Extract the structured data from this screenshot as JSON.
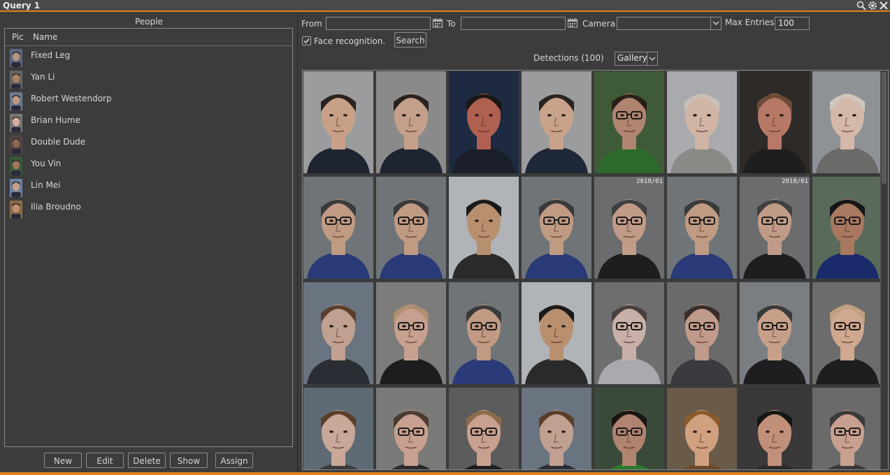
{
  "window": {
    "title": "Query 1"
  },
  "people": {
    "label": "People",
    "col_pic": "Pic",
    "col_name": "Name",
    "items": [
      {
        "name": "Fixed Leg",
        "skin": "#b89478",
        "bg": "#5a6880"
      },
      {
        "name": "Yan Li",
        "skin": "#a88466",
        "bg": "#666"
      },
      {
        "name": "Robert Westendorp",
        "skin": "#c09a80",
        "bg": "#6b7a90"
      },
      {
        "name": "Brian Hume",
        "skin": "#d6b0a0",
        "bg": "#787878"
      },
      {
        "name": "Double Dude",
        "skin": "#8a6a50",
        "bg": "#544"
      },
      {
        "name": "You Vin",
        "skin": "#a0785a",
        "bg": "#3a5a3a"
      },
      {
        "name": "Lin Mei",
        "skin": "#c8a088",
        "bg": "#6c80a0"
      },
      {
        "name": "Ilia Broudno",
        "skin": "#c09070",
        "bg": "#8a6a4a"
      }
    ],
    "buttons": {
      "new": "New",
      "edit": "Edit",
      "delete": "Delete",
      "show": "Show",
      "assign": "Assign"
    }
  },
  "query": {
    "from_label": "From",
    "to_label": "To",
    "camera_label": "Camera",
    "max_entries_label": "Max Entries",
    "max_entries_value": "100",
    "from_value": "",
    "to_value": "",
    "camera_value": "",
    "face_recognition_label": "Face recognition.",
    "face_recognition_checked": true,
    "search_label": "Search"
  },
  "detections": {
    "label": "Detections (100)",
    "view_mode": "Gallery",
    "tiles": [
      {
        "bg": "#9a9c9e",
        "skin": "#c8a088",
        "shirt": "#1e2430",
        "hair": "#2a2320",
        "glasses": false
      },
      {
        "bg": "#8a8a8a",
        "skin": "#c4a08a",
        "shirt": "#1e2430",
        "hair": "#2a2320",
        "glasses": false
      },
      {
        "bg": "#1d2a42",
        "skin": "#b06050",
        "shirt": "#1a1f2a",
        "hair": "#1a1614",
        "glasses": false
      },
      {
        "bg": "#9a9c9e",
        "skin": "#c8a28a",
        "shirt": "#1e2838",
        "hair": "#2a2320",
        "glasses": false
      },
      {
        "bg": "#3e5a36",
        "skin": "#b08470",
        "shirt": "#2c6a2c",
        "hair": "#2a2018",
        "glasses": true
      },
      {
        "bg": "#a8aaae",
        "skin": "#d0b4a4",
        "shirt": "#8a8a86",
        "hair": "#c8c0b8",
        "glasses": false
      },
      {
        "bg": "#2e2a28",
        "skin": "#b87868",
        "shirt": "#1e1e1e",
        "hair": "#6a4a36",
        "glasses": false
      },
      {
        "bg": "#8e9296",
        "skin": "#d4b8aa",
        "shirt": "#6a6a68",
        "hair": "#d0c8c0",
        "glasses": false
      },
      {
        "bg": "#6e7478",
        "skin": "#c09a82",
        "shirt": "#2a3a78",
        "hair": "#3a3a3a",
        "glasses": true
      },
      {
        "bg": "#6e7478",
        "skin": "#c09a82",
        "shirt": "#2a3a78",
        "hair": "#3a3a3a",
        "glasses": true
      },
      {
        "bg": "#b0b4b8",
        "skin": "#b89070",
        "shirt": "#2a2a2a",
        "hair": "#1a1a1a",
        "glasses": false
      },
      {
        "bg": "#6e7478",
        "skin": "#c09a82",
        "shirt": "#2a3a78",
        "hair": "#3a3a3a",
        "glasses": true
      },
      {
        "bg": "#6a6c6e",
        "skin": "#c09c88",
        "shirt": "#1e1e20",
        "hair": "#404040",
        "glasses": true,
        "stamp": "2018/01"
      },
      {
        "bg": "#6e7478",
        "skin": "#c09a82",
        "shirt": "#2a3a78",
        "hair": "#3a3a3a",
        "glasses": true
      },
      {
        "bg": "#6a6c6e",
        "skin": "#c09c88",
        "shirt": "#1e1e20",
        "hair": "#404040",
        "glasses": true,
        "stamp": "2018/01"
      },
      {
        "bg": "#5a6a5a",
        "skin": "#a87860",
        "shirt": "#1a2a6a",
        "hair": "#151515",
        "glasses": true
      },
      {
        "bg": "#6a7480",
        "skin": "#c0a090",
        "shirt": "#2a2e34",
        "hair": "#5a3e2a",
        "glasses": false
      },
      {
        "bg": "#7e7c7a",
        "skin": "#c8a090",
        "shirt": "#1e1e1e",
        "hair": "#b09070",
        "glasses": true
      },
      {
        "bg": "#6e7478",
        "skin": "#c09a82",
        "shirt": "#2a3a78",
        "hair": "#3a3a3a",
        "glasses": true
      },
      {
        "bg": "#b0b4b8",
        "skin": "#b89070",
        "shirt": "#2a2a2a",
        "hair": "#1a1a1a",
        "glasses": false
      },
      {
        "bg": "#6e6e6e",
        "skin": "#c8b0a8",
        "shirt": "#a8aab0",
        "hair": "#4a4040",
        "glasses": true
      },
      {
        "bg": "#6a6a6a",
        "skin": "#c09a8a",
        "shirt": "#3a3a40",
        "hair": "#3a2e2a",
        "glasses": true
      },
      {
        "bg": "#7a7e82",
        "skin": "#c8a08a",
        "shirt": "#1e1e20",
        "hair": "#3a3a3a",
        "glasses": true
      },
      {
        "bg": "#6c6c6c",
        "skin": "#d0a890",
        "shirt": "#1e1e1e",
        "hair": "#c0a080",
        "glasses": true
      },
      {
        "bg": "#5e6a74",
        "skin": "#c8a898",
        "shirt": "#3a3a3a",
        "hair": "#5a3e2a",
        "glasses": false
      },
      {
        "bg": "#7a7a78",
        "skin": "#c8a090",
        "shirt": "#2a2a2a",
        "hair": "#4a3a30",
        "glasses": true
      },
      {
        "bg": "#5c5c5c",
        "skin": "#c8a090",
        "shirt": "#1e1e1e",
        "hair": "#8a6a4a",
        "glasses": true
      },
      {
        "bg": "#6a7480",
        "skin": "#c0a090",
        "shirt": "#2a2e34",
        "hair": "#5a3e2a",
        "glasses": false
      },
      {
        "bg": "#3a4a3a",
        "skin": "#b08470",
        "shirt": "#2c7a2c",
        "hair": "#1a1614",
        "glasses": true
      },
      {
        "bg": "#6a5a4a",
        "skin": "#d0a080",
        "shirt": "#6a4a2a",
        "hair": "#8a5a2a",
        "glasses": false
      },
      {
        "bg": "#3a3838",
        "skin": "#c0907a",
        "shirt": "#2a2a2a",
        "hair": "#151515",
        "glasses": false
      },
      {
        "bg": "#6a6a6a",
        "skin": "#c8a090",
        "shirt": "#3a3a3a",
        "hair": "#3a3a3a",
        "glasses": true
      }
    ]
  }
}
